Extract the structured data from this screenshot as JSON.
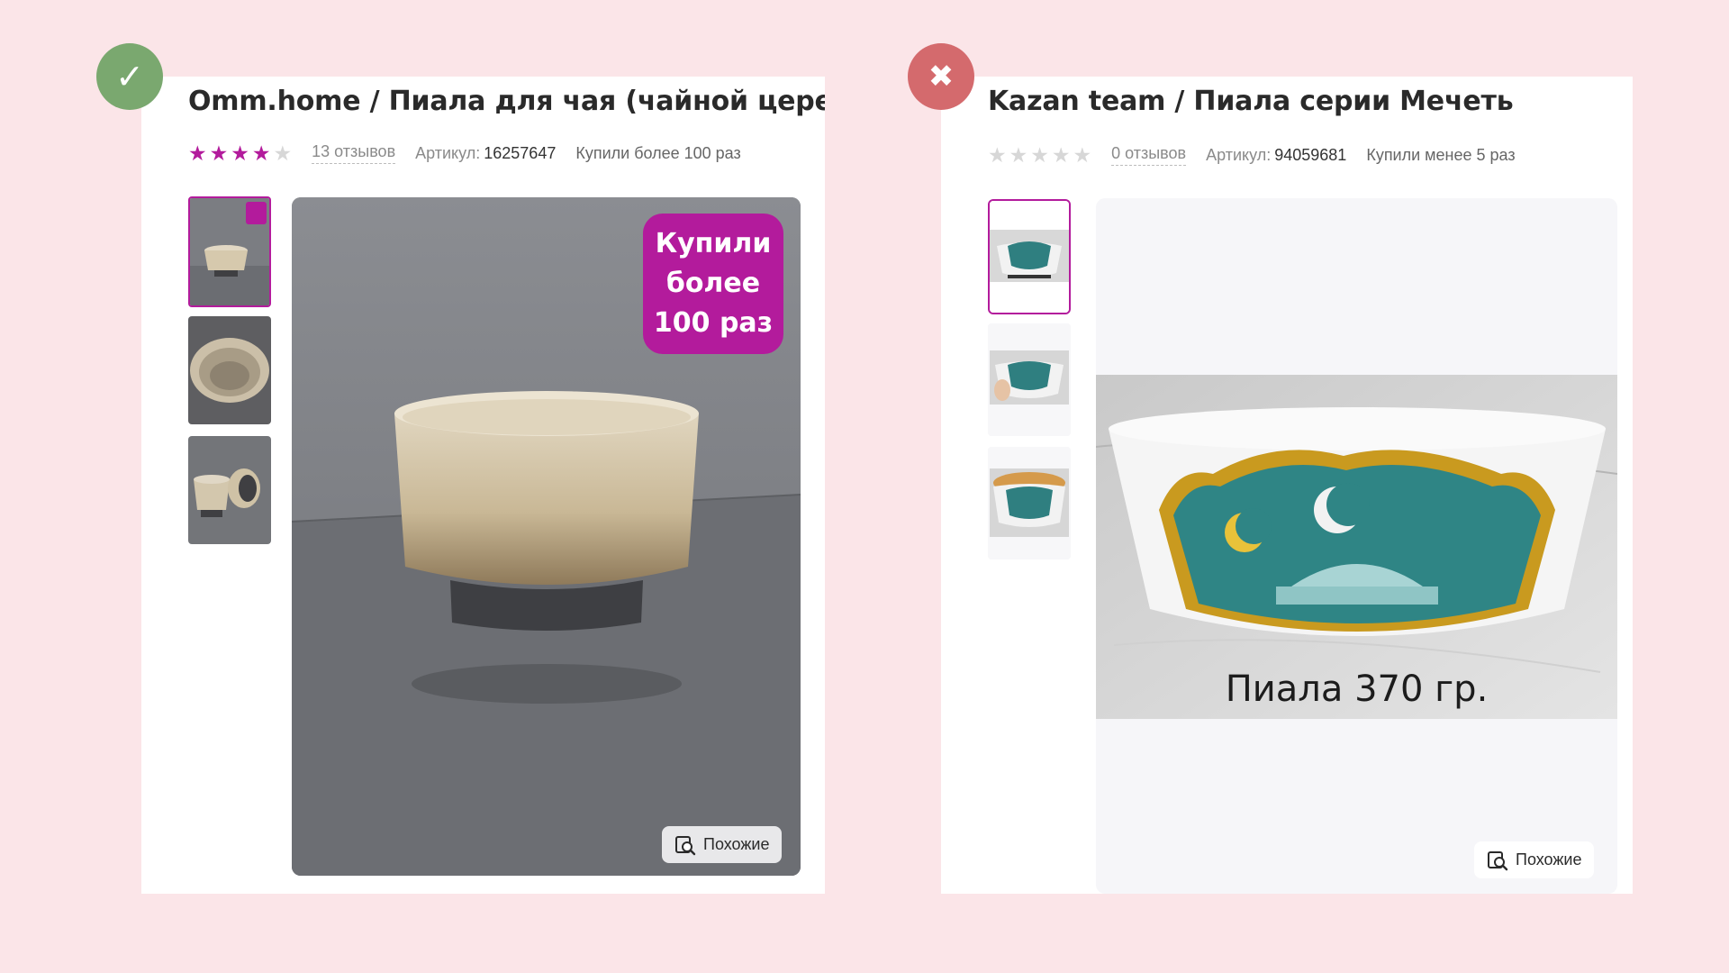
{
  "left": {
    "status_icon": "✓",
    "status_name": "check-icon",
    "title": "Omm.home / Пиала для чая (чайной церемон",
    "rating": 4,
    "max_rating": 5,
    "reviews_label": "13 отзывов",
    "article_label": "Артикул:",
    "article_value": "16257647",
    "bought_label": "Купили более 100 раз",
    "promo_line1": "Купили",
    "promo_line2": "более",
    "promo_line3": "100 раз",
    "similar_label": "Похожие",
    "thumb_badge_text": "Купили более 100 раз"
  },
  "right": {
    "status_icon": "✖",
    "status_name": "cross-icon",
    "title": "Kazan team / Пиала серии Мечеть",
    "rating": 0,
    "max_rating": 5,
    "reviews_label": "0 отзывов",
    "article_label": "Артикул:",
    "article_value": "94059681",
    "bought_label": "Купили менее 5 раз",
    "image_caption": "Пиала 370 гр.",
    "similar_label": "Похожие"
  },
  "colors": {
    "page_background": "#fbe5e8",
    "accent": "#b31b9c",
    "success": "#7aa86f",
    "error": "#d46a6d"
  }
}
